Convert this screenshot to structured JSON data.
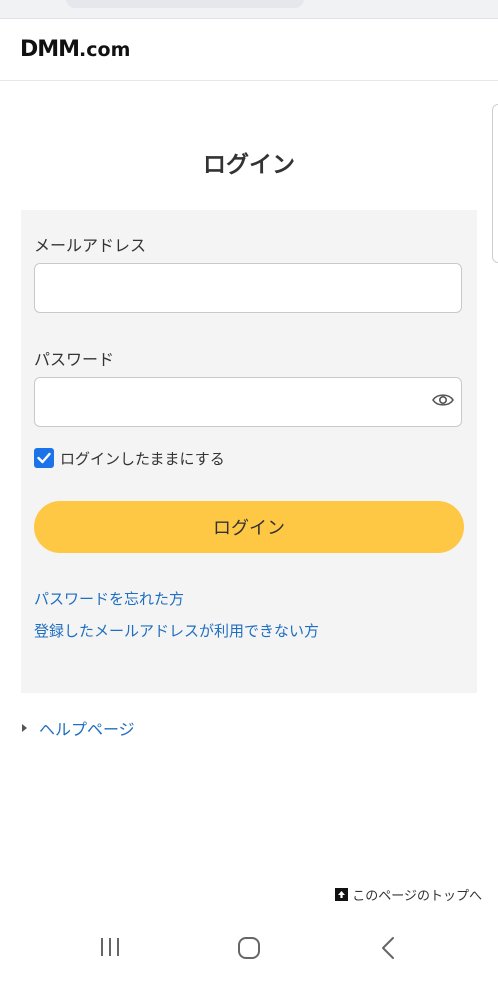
{
  "header": {
    "logo": "DMM",
    "logo_suffix": ".com"
  },
  "page": {
    "title": "ログイン"
  },
  "form": {
    "email_label": "メールアドレス",
    "email_value": "",
    "password_label": "パスワード",
    "password_value": "",
    "remember_label": "ログインしたままにする",
    "remember_checked": true,
    "submit_label": "ログイン"
  },
  "links": {
    "forgot_password": "パスワードを忘れた方",
    "email_unavailable": "登録したメールアドレスが利用できない方"
  },
  "help": {
    "label": "ヘルプページ"
  },
  "footer": {
    "to_top": "このページのトップへ"
  },
  "colors": {
    "accent": "#ffc844",
    "link": "#1f6fc0",
    "checkbox": "#1a73e8",
    "panel": "#f4f4f4"
  },
  "icons": {
    "eye": "eye-icon",
    "check": "check-icon",
    "to_top": "arrow-up-icon",
    "recent_apps": "recent-apps-icon",
    "home": "home-icon",
    "back": "back-icon"
  }
}
